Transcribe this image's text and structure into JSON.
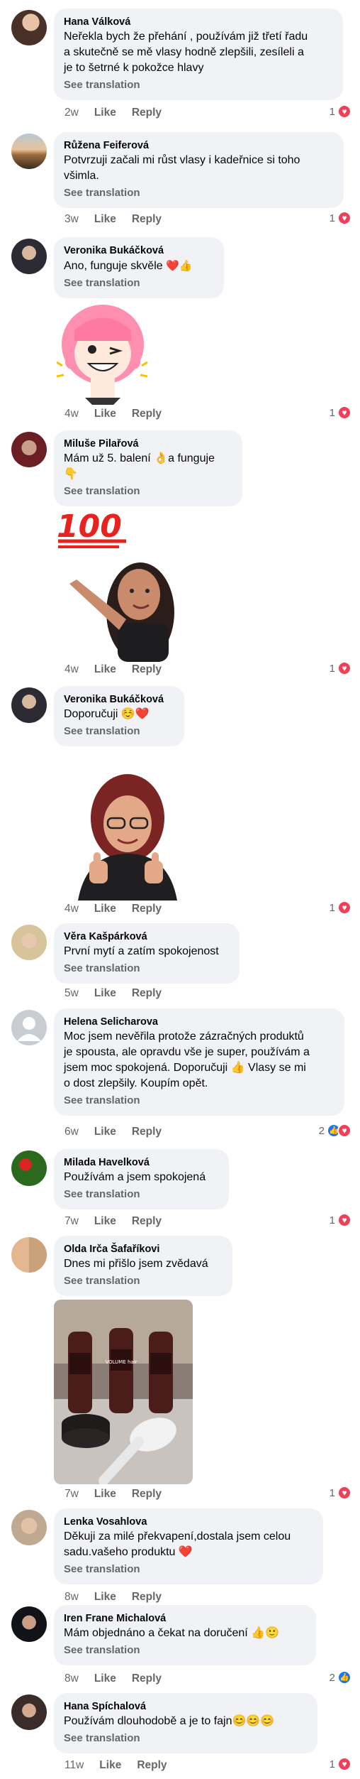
{
  "ui": {
    "like": "Like",
    "reply": "Reply",
    "see_translation": "See translation"
  },
  "comments": [
    {
      "name": "Hana Válková",
      "lines": [
        "Neřekla bych že přehání , používám již třetí řadu",
        "a skutečně se mě vlasy hodně zlepšili, zesíleli a",
        "je to šetrné k pokožce hlavy"
      ],
      "time": "2w",
      "reactions": "1"
    },
    {
      "name": "Růžena Feiferová",
      "lines": [
        "Potvrzuji  začali mi růst vlasy i kadeřnice  si toho",
        "všimla."
      ],
      "time": "3w",
      "reactions": "1"
    },
    {
      "name": "Veronika Bukáčková",
      "lines": [
        "Ano, funguje skvěle"
      ],
      "emoji": "❤️👍",
      "time": "4w",
      "reactions": "1"
    },
    {
      "name": "Miluše Pilařová",
      "lines": [
        "Mám už 5. balení 👌a funguje",
        "👇"
      ],
      "time": "4w",
      "reactions": "1",
      "sticker_text": "100"
    },
    {
      "name": "Veronika Bukáčková",
      "lines": [
        "Doporučuji ☺️❤️"
      ],
      "time": "4w",
      "reactions": "1"
    },
    {
      "name": "Věra Kašpárková",
      "lines": [
        "První mytí a zatím spokojenost"
      ],
      "time": "5w",
      "reactions": ""
    },
    {
      "name": "Helena Selicharova",
      "lines": [
        "Moc jsem nevěřila protože zázračných produktů",
        "je spousta, ale opravdu vše je super, používám a",
        "jsem moc spokojená. Doporučuji 👍 Vlasy se mi",
        "o dost zlepšily. Koupím opět."
      ],
      "time": "6w",
      "reactions": "2"
    },
    {
      "name": "Milada Havelková",
      "lines": [
        "Používám a jsem spokojená"
      ],
      "time": "7w",
      "reactions": "1"
    },
    {
      "name": "Olda Irča Šafaříkovi",
      "lines": [
        "Dnes mi přišlo jsem zvědavá"
      ],
      "time": "7w",
      "reactions": "1",
      "product_label": "VOLUME hair"
    },
    {
      "name": "Lenka Vosahlova",
      "lines": [
        "Děkuji za milé překvapení,dostala jsem celou",
        "sadu.vašeho produktu ❤️"
      ],
      "time": "8w",
      "reactions": ""
    },
    {
      "name": "Iren Frane Michalová",
      "lines": [
        "Mám objednáno a čekat na doručení 👍🙂"
      ],
      "time": "8w",
      "reactions": "2"
    },
    {
      "name": "Hana Spíchalová",
      "lines": [
        "Používám dlouhodobě  a je to fajn😊😊😊"
      ],
      "time": "11w",
      "reactions": "1"
    }
  ],
  "colors": {
    "bubble": "#f0f2f5",
    "meta": "#65676b",
    "heart": "#f33e58",
    "like": "#1877f2"
  }
}
